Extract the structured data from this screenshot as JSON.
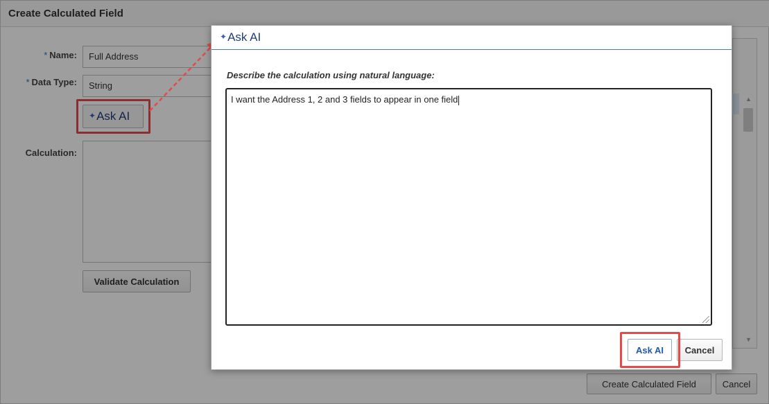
{
  "background_dialog": {
    "title": "Create Calculated Field",
    "name_label": "Name:",
    "name_value": "Full Address",
    "data_type_label": "Data Type:",
    "data_type_value": "String",
    "ask_ai_label": "Ask AI",
    "calculation_label": "Calculation:",
    "validate_label": "Validate Calculation",
    "create_label": "Create Calculated Field",
    "cancel_label": "Cancel",
    "required_marker": "*"
  },
  "modal": {
    "title": "Ask AI",
    "prompt_label": "Describe the calculation using natural language:",
    "prompt_value": "I want the Address 1, 2 and 3 fields to appear in one field",
    "ask_ai_button": "Ask AI",
    "cancel_button": "Cancel"
  },
  "icons": {
    "sparkle": "sparkle-icon",
    "resize": "resize-grip-icon",
    "scroll_up": "chevron-up-icon",
    "scroll_down": "chevron-down-icon"
  },
  "colors": {
    "accent": "#1f3d7a",
    "highlight": "#e24b4b",
    "overlay": "rgba(0,0,0,0.38)"
  }
}
